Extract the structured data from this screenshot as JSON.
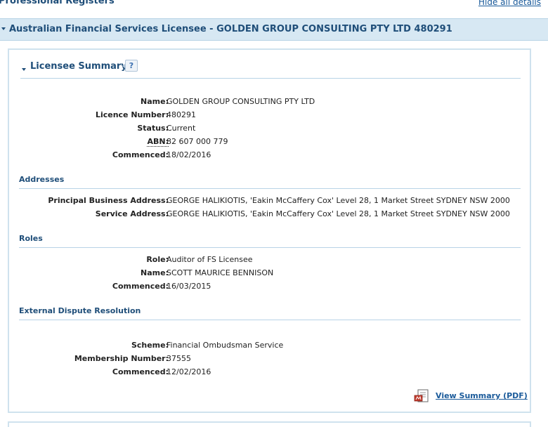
{
  "page": {
    "top_title": "Professional Registers",
    "hide_all_label": "Hide all details"
  },
  "header": {
    "title": "Australian Financial Services Licensee - GOLDEN GROUP CONSULTING PTY LTD 480291"
  },
  "summary": {
    "title": "Licensee Summary",
    "help_label": "?",
    "rows": [
      {
        "label": "Name:",
        "value": "GOLDEN GROUP CONSULTING PTY LTD"
      },
      {
        "label": "Licence Number:",
        "value": "480291"
      },
      {
        "label": "Status:",
        "value": "Current"
      },
      {
        "label": "ABN:",
        "value": "82 607 000 779"
      },
      {
        "label": "Commenced:",
        "value": "18/02/2016"
      }
    ]
  },
  "addresses": {
    "title": "Addresses",
    "rows": [
      {
        "label": "Principal Business Address:",
        "value": "GEORGE HALIKIOTIS, 'Eakin McCaffery Cox' Level 28, 1 Market Street SYDNEY NSW 2000"
      },
      {
        "label": "Service Address:",
        "value": "GEORGE HALIKIOTIS, 'Eakin McCaffery Cox' Level 28, 1 Market Street SYDNEY NSW 2000"
      }
    ]
  },
  "roles": {
    "title": "Roles",
    "rows": [
      {
        "label": "Role:",
        "value": "Auditor of FS Licensee"
      },
      {
        "label": "Name:",
        "value": "SCOTT MAURICE BENNISON"
      },
      {
        "label": "Commenced:",
        "value": "16/03/2015"
      }
    ]
  },
  "edr": {
    "title": "External Dispute Resolution",
    "rows": [
      {
        "label": "Scheme:",
        "value": "Financial Ombudsman Service"
      },
      {
        "label": "Membership Number:",
        "value": "37555"
      },
      {
        "label": "Commenced:",
        "value": "12/02/2016"
      }
    ]
  },
  "pdf": {
    "label": "View Summary (PDF)",
    "icon": "pdf-document-icon"
  },
  "colors": {
    "accent": "#1f4e79",
    "link": "#1a5a9a",
    "header_bg": "#d7e8f3",
    "border": "#cfe2ee"
  }
}
